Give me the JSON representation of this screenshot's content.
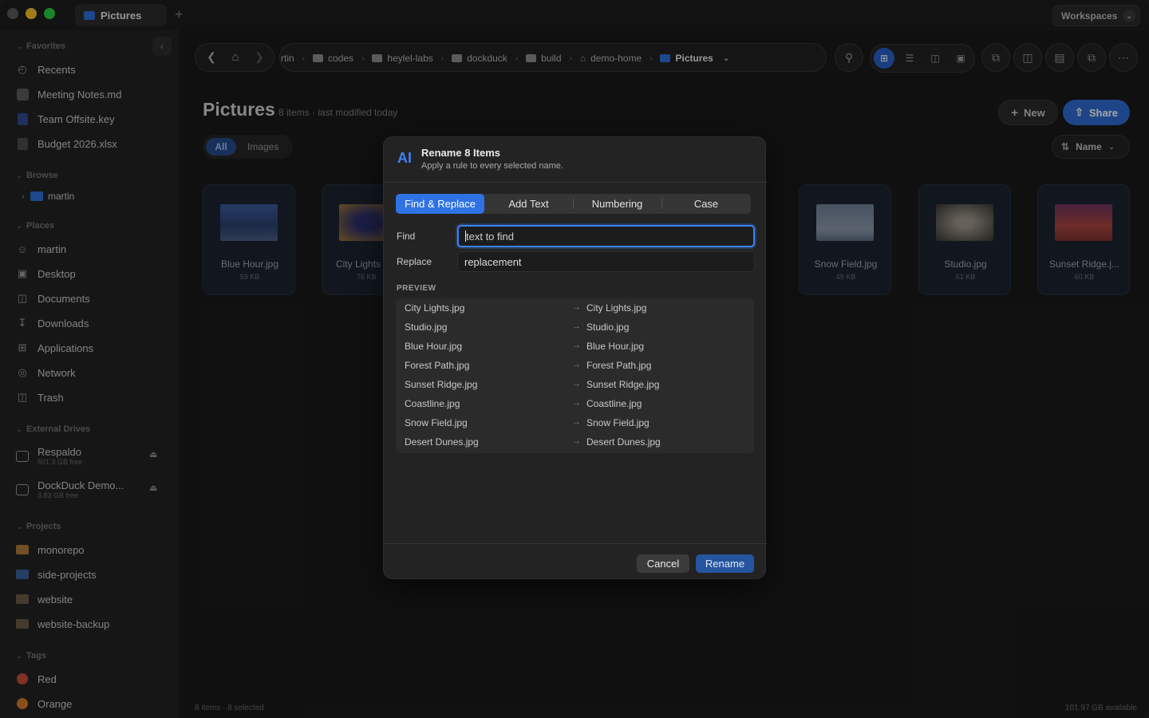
{
  "titlebar": {
    "tab_label": "Pictures",
    "new_tab": "+",
    "workspaces_label": "Workspaces"
  },
  "sidebar": {
    "favorites_header": "Favorites",
    "favorites": [
      {
        "label": "Recents"
      },
      {
        "label": "Meeting Notes.md"
      },
      {
        "label": "Team Offsite.key"
      },
      {
        "label": "Budget 2026.xlsx"
      }
    ],
    "browse_header": "Browse",
    "browse": [
      {
        "label": "martin"
      }
    ],
    "places_header": "Places",
    "places": [
      {
        "label": "martin"
      },
      {
        "label": "Desktop"
      },
      {
        "label": "Documents"
      },
      {
        "label": "Downloads"
      },
      {
        "label": "Applications"
      },
      {
        "label": "Network"
      },
      {
        "label": "Trash"
      }
    ],
    "drives_header": "External Drives",
    "drives": [
      {
        "label": "Respaldo",
        "sub": "501.3 GB free"
      },
      {
        "label": "DockDuck Demo...",
        "sub": "3.83 GB free"
      }
    ],
    "projects_header": "Projects",
    "projects": [
      {
        "label": "monorepo",
        "color": "#b07a3a"
      },
      {
        "label": "side-projects",
        "color": "#3b5f9a"
      },
      {
        "label": "website",
        "color": "#6b5a45"
      },
      {
        "label": "website-backup",
        "color": "#6b5a45"
      }
    ],
    "tags_header": "Tags",
    "tags": [
      {
        "label": "Red",
        "color": "#c94a3a"
      },
      {
        "label": "Orange",
        "color": "#d37a2a"
      }
    ]
  },
  "breadcrumbs": [
    {
      "label": "rtin"
    },
    {
      "label": "codes"
    },
    {
      "label": "heylel-labs"
    },
    {
      "label": "dockduck"
    },
    {
      "label": "build"
    },
    {
      "label": "demo-home"
    },
    {
      "label": "Pictures"
    }
  ],
  "main": {
    "title": "Pictures",
    "meta": "8 items · last modified today",
    "new_label": "New",
    "share_label": "Share",
    "filter_all": "All",
    "filter_images": "Images",
    "sort_label": "Name"
  },
  "cards": [
    {
      "name": "Blue Hour.jpg",
      "size": "59 KB"
    },
    {
      "name": "City Lights",
      "size": "76 KB"
    },
    {
      "name": "Snow Field.jpg",
      "size": "49 KB"
    },
    {
      "name": "Studio.jpg",
      "size": "61 KB"
    },
    {
      "name": "Sunset Ridge.j...",
      "size": "60 KB"
    }
  ],
  "status": {
    "left": "8 items · 8 selected",
    "right": "101.97 GB available"
  },
  "dialog": {
    "icon": "AI",
    "title": "Rename 8 Items",
    "subtitle": "Apply a rule to every selected name.",
    "tabs": [
      "Find & Replace",
      "Add Text",
      "Numbering",
      "Case"
    ],
    "find_label": "Find",
    "find_placeholder": "text to find",
    "replace_label": "Replace",
    "replace_value": "replacement",
    "preview_header": "PREVIEW",
    "preview": [
      {
        "old": "City Lights.jpg",
        "new": "City Lights.jpg"
      },
      {
        "old": "Studio.jpg",
        "new": "Studio.jpg"
      },
      {
        "old": "Blue Hour.jpg",
        "new": "Blue Hour.jpg"
      },
      {
        "old": "Forest Path.jpg",
        "new": "Forest Path.jpg"
      },
      {
        "old": "Sunset Ridge.jpg",
        "new": "Sunset Ridge.jpg"
      },
      {
        "old": "Coastline.jpg",
        "new": "Coastline.jpg"
      },
      {
        "old": "Snow Field.jpg",
        "new": "Snow Field.jpg"
      },
      {
        "old": "Desert Dunes.jpg",
        "new": "Desert Dunes.jpg"
      }
    ],
    "cancel_label": "Cancel",
    "rename_label": "Rename"
  }
}
